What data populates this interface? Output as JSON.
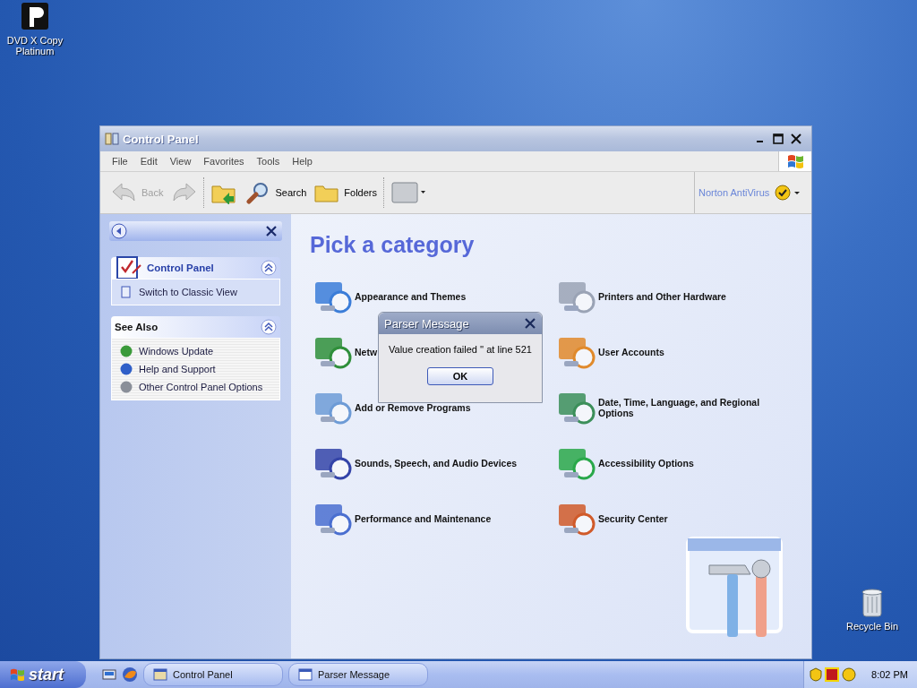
{
  "desktop_icons": [
    {
      "label": "DVD X Copy Platinum",
      "kind": "dvd"
    },
    {
      "label": "Recycle Bin",
      "kind": "bin"
    }
  ],
  "window": {
    "title": "Control Panel",
    "menu": [
      "File",
      "Edit",
      "View",
      "Favorites",
      "Tools",
      "Help"
    ],
    "toolbar": [
      {
        "kind": "back",
        "label": "Back",
        "disabled": true
      },
      {
        "kind": "forward",
        "disabled": true
      },
      {
        "kind": "up"
      },
      {
        "kind": "search",
        "label": "Search"
      },
      {
        "kind": "folders",
        "label": "Folders"
      },
      {
        "kind": "views"
      }
    ],
    "norton": {
      "label": "Norton AntiVirus"
    },
    "sidebar": {
      "panels": [
        {
          "title": "Control Panel",
          "kind": "main",
          "expanded": true,
          "items": [
            "Switch to Classic View"
          ]
        },
        {
          "title": "See Also",
          "kind": "plain",
          "expanded": true,
          "items": [
            "Windows Update",
            "Help and Support",
            "Other Control Panel Options"
          ]
        }
      ]
    },
    "heading": "Pick a category",
    "categories": [
      "Appearance and Themes",
      "Printers and Other Hardware",
      "Netw",
      "User Accounts",
      "Add or Remove Programs",
      "Date, Time, Language, and Regional Options",
      "Sounds, Speech, and Audio Devices",
      "Accessibility Options",
      "Performance and Maintenance",
      "Security Center"
    ]
  },
  "dialog": {
    "title": "Parser Message",
    "message": "Value creation failed '' at line 521",
    "button": "OK"
  },
  "taskbar": {
    "start": "start",
    "tasks": [
      "Control Panel",
      "Parser Message"
    ],
    "clock": "8:02 PM"
  }
}
